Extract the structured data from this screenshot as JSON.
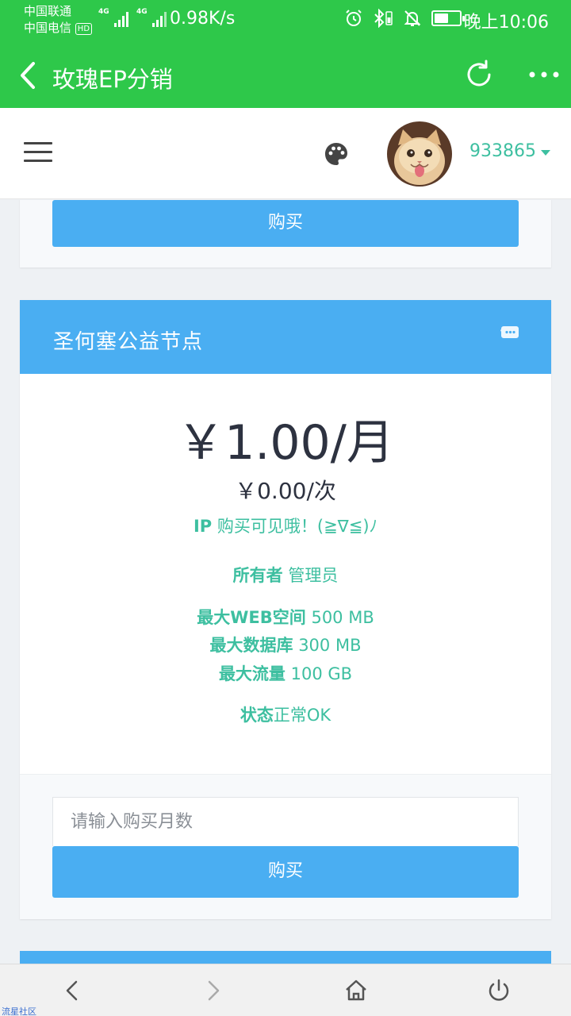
{
  "status_bar": {
    "carrier_1": "中国联通",
    "carrier_2": "中国电信",
    "hd_badge": "HD",
    "network_1": "4G",
    "network_2": "4G",
    "net_speed": "0.98K/s",
    "battery_level": 0.55,
    "time": "晚上10:06"
  },
  "title_bar": {
    "title": "玫瑰EP分销",
    "back_icon": "chevron-left-icon",
    "refresh_icon": "refresh-icon",
    "more_icon": "more-dots-icon"
  },
  "app_header": {
    "menu_icon": "hamburger-icon",
    "theme_icon": "palette-icon",
    "username": "933865"
  },
  "previous_card": {
    "buy_label": "购买"
  },
  "node_card": {
    "title": "圣何塞公益节点",
    "header_icon": "comment-icon",
    "price_monthly": "￥1.00/月",
    "price_per_use": "￥0.00/次",
    "ip_label": "IP",
    "ip_text": "购买可见哦！(≧∇≦)ﾉ",
    "owner_label": "所有者",
    "owner_value": "管理员",
    "web_space_label": "最大WEB空间",
    "web_space_value": "500 MB",
    "database_label": "最大数据库",
    "database_value": "300 MB",
    "traffic_label": "最大流量",
    "traffic_value": "100 GB",
    "status_label": "状态",
    "status_value": "正常OK",
    "months_placeholder": "请输入购买月数",
    "buy_label": "购买"
  },
  "nav_bar": {
    "back_icon": "chevron-left-icon",
    "forward_icon": "chevron-right-icon",
    "home_icon": "home-icon",
    "power_icon": "power-icon"
  },
  "watermark": "流星社区",
  "colors": {
    "brand_green": "#2ec84a",
    "card_blue": "#4aaef2",
    "teal_text": "#3dbfa0"
  }
}
